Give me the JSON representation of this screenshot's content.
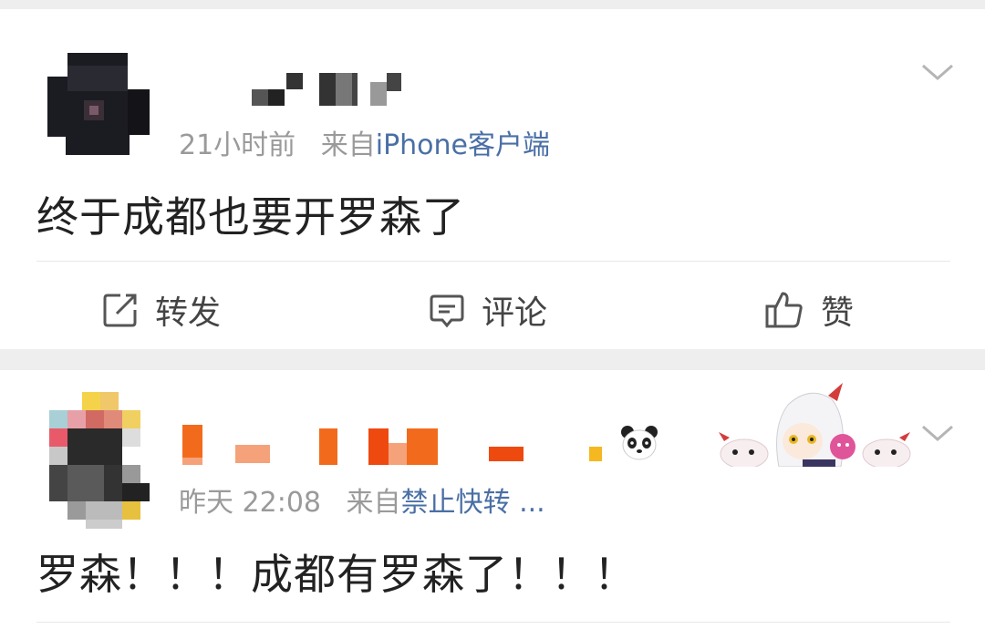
{
  "post1": {
    "time": "21小时前",
    "from_prefix": "来自",
    "source": "iPhone客户端",
    "content": "终于成都也要开罗森了",
    "actions": {
      "repost": "转发",
      "comment": "评论",
      "like": "赞"
    }
  },
  "post2": {
    "time": "昨天 22:08",
    "from_prefix": "来自",
    "source": "禁止快转 ...",
    "content": "罗森！！！成都有罗森了！！！"
  },
  "colors": {
    "background": "#eeeeee",
    "card": "#ffffff",
    "source_link": "#4a6fa5",
    "meta_gray": "#9a9a9a",
    "username_pixel_orange": "#f26b1d"
  },
  "icons": [
    "chevron-down-icon",
    "repost-icon",
    "comment-icon",
    "like-icon",
    "panda-emoji-icon"
  ]
}
